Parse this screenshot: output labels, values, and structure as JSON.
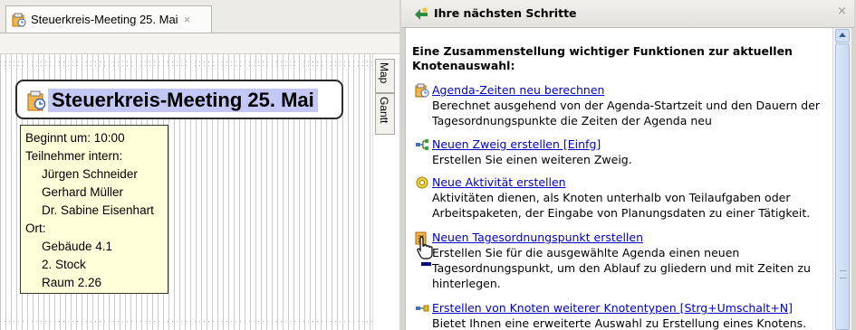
{
  "editor": {
    "tab_label": "Steuerkreis-Meeting 25. Mai",
    "tab_close": "×",
    "side_tabs": {
      "map": "Map",
      "gantt": "Gantt"
    },
    "node": {
      "title": "Steuerkreis-Meeting 25. Mai"
    },
    "tooltip": {
      "begins": "Beginnt um: 10:00",
      "participants_label": "Teilnehmer intern:",
      "participants": [
        "Jürgen Schneider",
        "Gerhard Müller",
        "Dr. Sabine Eisenhart"
      ],
      "location_label": "Ort:",
      "location": [
        "Gebäude 4.1",
        "2. Stock",
        "Raum 2.26"
      ]
    }
  },
  "panel": {
    "title": "Ihre nächsten Schritte",
    "close": "×",
    "intro": [
      "Eine Zusammenstellung wichtiger Funktionen zur aktuellen",
      "Knotenauswahl:"
    ],
    "items": [
      {
        "icon": "agenda-calc-icon",
        "link": "Agenda-Zeiten neu berechnen",
        "desc": [
          "Berechnet ausgehend von der Agenda-Startzeit und den Dauern der",
          "Tagesordnungspunkte die Zeiten der Agenda neu"
        ]
      },
      {
        "icon": "branch-icon",
        "link": "Neuen Zweig erstellen [Einfg]",
        "desc": [
          "Erstellen Sie einen weiteren Zweig."
        ]
      },
      {
        "icon": "activity-icon",
        "link": "Neue Aktivität erstellen",
        "desc": [
          "Aktivitäten dienen, als Knoten unterhalb von Teilaufgaben oder",
          "Arbeitspaketen, der Eingabe von Planungsdaten zu einer Tätigkeit."
        ]
      },
      {
        "icon": "agenda-item-icon",
        "link": "Neuen Tagesordnungspunkt erstellen",
        "desc": [
          "Erstellen Sie für die ausgewählte Agenda einen neuen",
          "Tagesordnungspunkt, um den Ablauf zu gliedern und mit Zeiten zu",
          "hinterlegen."
        ]
      },
      {
        "icon": "node-types-icon",
        "link": "Erstellen von Knoten weiterer Knotentypen [Strg+Umschalt+N]",
        "desc": [
          "Bietet Ihnen eine erweiterte Auswahl zu Erstellung eines Knotens."
        ]
      }
    ]
  },
  "colors": {
    "selection": "#c4c8f6",
    "tooltip_bg": "#ffffd9",
    "link": "#0000cc"
  }
}
